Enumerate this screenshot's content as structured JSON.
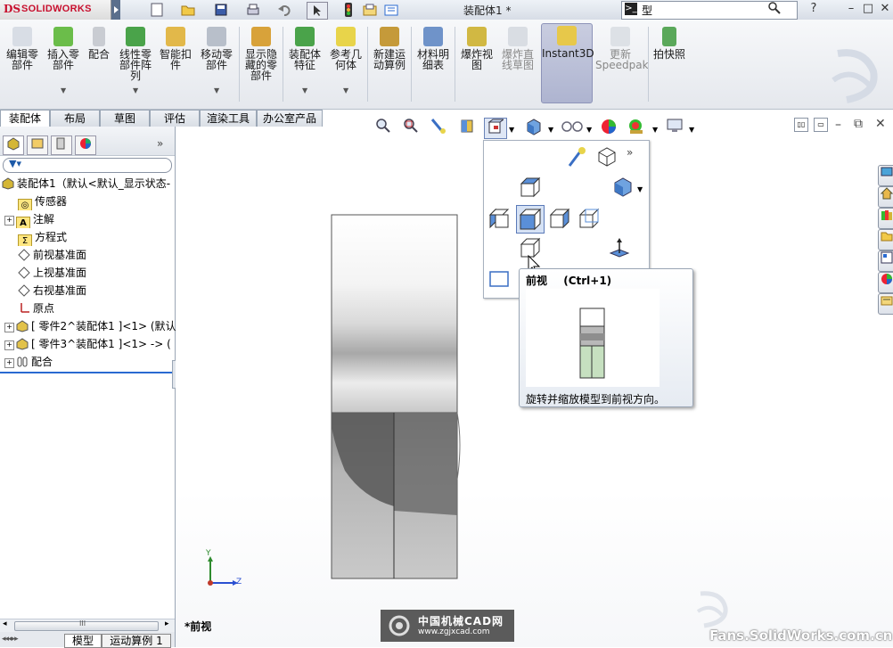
{
  "app": {
    "brand": "SOLIDWORKS",
    "brand_mark": "DS",
    "document_title": "装配体1 *"
  },
  "search": {
    "prefix_glyph": ">_",
    "placeholder": "型"
  },
  "window_buttons": {
    "help": "?",
    "minimize": "–",
    "maximize": "□",
    "close": "✕"
  },
  "commands": [
    {
      "label": "编辑零部件",
      "icon": "edit-component-icon",
      "enabled": true
    },
    {
      "label": "插入零部件",
      "icon": "insert-component-icon",
      "enabled": true
    },
    {
      "label": "配合",
      "icon": "mate-icon",
      "enabled": true
    },
    {
      "label": "线性零部件阵列",
      "icon": "linear-pattern-icon",
      "enabled": true
    },
    {
      "label": "智能扣件",
      "icon": "smart-fasteners-icon",
      "enabled": true
    },
    {
      "label": "移动零部件",
      "icon": "move-component-icon",
      "enabled": true
    },
    {
      "label": "显示隐藏的零部件",
      "icon": "show-hidden-icon",
      "enabled": true
    },
    {
      "label": "装配体特征",
      "icon": "assembly-feature-icon",
      "enabled": true
    },
    {
      "label": "参考几何体",
      "icon": "reference-geometry-icon",
      "enabled": true
    },
    {
      "label": "新建运动算例",
      "icon": "motion-study-icon",
      "enabled": true
    },
    {
      "label": "材料明细表",
      "icon": "bom-icon",
      "enabled": true
    },
    {
      "label": "爆炸视图",
      "icon": "exploded-view-icon",
      "enabled": true
    },
    {
      "label": "爆炸直线草图",
      "icon": "explode-line-icon",
      "enabled": false
    },
    {
      "label": "Instant3D",
      "icon": "instant3d-icon",
      "enabled": true
    },
    {
      "label": "更新Speedpak",
      "icon": "speedpak-icon",
      "enabled": false
    },
    {
      "label": "拍快照",
      "icon": "snapshot-icon",
      "enabled": true
    }
  ],
  "tabs": [
    "装配体",
    "布局",
    "草图",
    "评估",
    "渲染工具",
    "办公室产品"
  ],
  "active_tab": "装配体",
  "tree": {
    "root": "装配体1（默认<默认_显示状态-",
    "items": [
      {
        "label": "传感器",
        "icon": "sensor-icon",
        "expandable": false
      },
      {
        "label": "注解",
        "icon": "annotation-icon",
        "expandable": true
      },
      {
        "label": "方程式",
        "icon": "equation-icon",
        "expandable": false
      },
      {
        "label": "前视基准面",
        "icon": "plane-icon",
        "expandable": false
      },
      {
        "label": "上视基准面",
        "icon": "plane-icon",
        "expandable": false
      },
      {
        "label": "右视基准面",
        "icon": "plane-icon",
        "expandable": false
      },
      {
        "label": "原点",
        "icon": "origin-icon",
        "expandable": false
      },
      {
        "label": "[ 零件2^装配体1 ]<1> (默认",
        "icon": "part-icon",
        "expandable": true
      },
      {
        "label": "[ 零件3^装配体1 ]<1> -> (",
        "icon": "part-icon",
        "expandable": true
      },
      {
        "label": "配合",
        "icon": "mates-folder-icon",
        "expandable": true
      }
    ]
  },
  "bottom_tabs": [
    "模型",
    "运动算例 1"
  ],
  "hscroll_label": "III",
  "view_tooltip": {
    "title": "前视",
    "shortcut": "(Ctrl+1)",
    "description": "旋转并缩放模型到前视方向。"
  },
  "triad": {
    "y": "Y",
    "z": "Z"
  },
  "view_name": "*前视",
  "watermark": {
    "cad_line1": "中国机械CAD网",
    "cad_line2": "www.zgjxcad.com",
    "fans": "Fans.SolidWorks.com.cn"
  },
  "colors": {
    "accent_blue": "#2a6ad1",
    "brand_red": "#c8102e"
  }
}
